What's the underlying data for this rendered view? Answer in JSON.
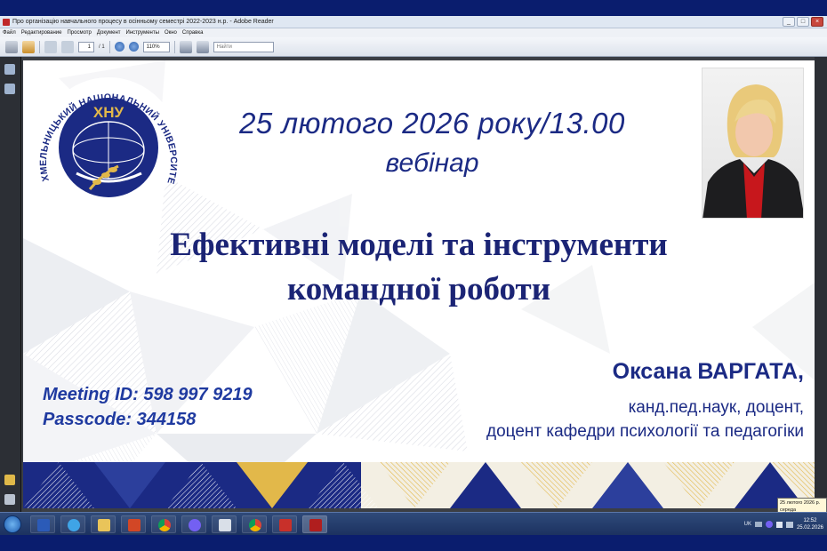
{
  "window": {
    "title": "Про організацію навчального процесу  в осінньому семестрі  2022-2023 н.р. - Adobe Reader",
    "controls": [
      "_",
      "□",
      "×"
    ]
  },
  "menu": {
    "items": [
      "Файл",
      "Редактирование",
      "Просмотр",
      "Документ",
      "Инструменты",
      "Окно",
      "Справка"
    ]
  },
  "toolbar": {
    "page_current": "1",
    "page_total": "/ 1",
    "zoom": "110%",
    "search_placeholder": "Найти",
    "icons": [
      "print-icon",
      "email-icon",
      "prev-page-icon",
      "next-page-icon",
      "zoom-out-icon",
      "zoom-in-icon",
      "save-icon",
      "fit-icon"
    ]
  },
  "slide": {
    "logo_text": "ХМЕЛЬНИЦЬКИЙ НАЦІОНАЛЬНИЙ УНІВЕРСИТЕТ",
    "logo_abbr": "ХНУ",
    "date_line": "25 лютого 2026 року/13.00",
    "format_line": "вебінар",
    "title_line1": "Ефективні моделі та інструменти",
    "title_line2": "командної роботи",
    "meeting_id": "Meeting ID: 598 997 9219",
    "passcode": "Passcode: 344158",
    "speaker_name": "Оксана ВАРГАТА,",
    "speaker_degree": "канд.пед.наук, доцент,",
    "speaker_position": "доцент кафедри психології та педагогіки",
    "colors": {
      "navy": "#1b2a84",
      "gold": "#e2b84a",
      "blue": "#1f3aa0"
    }
  },
  "taskbar": {
    "apps": [
      "word-icon",
      "ie-icon",
      "explorer-icon",
      "powerpoint-icon",
      "chrome-icon",
      "viber-icon",
      "paint-icon",
      "chrome-icon",
      "pdf-icon",
      "adobe-reader-icon"
    ],
    "lang": "UK",
    "time": "12:52",
    "date": "25.02.2026"
  },
  "tooltip": {
    "line1": "25 лютого 2026 р.",
    "line2": "середа"
  }
}
